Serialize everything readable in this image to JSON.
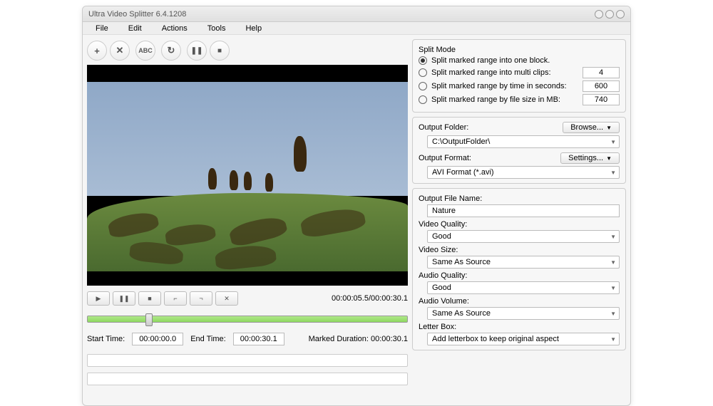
{
  "window": {
    "title": "Ultra Video Splitter 6.4.1208"
  },
  "menu": {
    "file": "File",
    "edit": "Edit",
    "actions": "Actions",
    "tools": "Tools",
    "help": "Help"
  },
  "toolbar": {
    "add": "+",
    "remove": "✕",
    "abc": "ABC",
    "refresh": "↻",
    "pause": "❚❚",
    "stop": "■"
  },
  "playback": {
    "play": "▶",
    "pause": "❚❚",
    "stop": "■",
    "markin": "⌐",
    "markout": "¬",
    "clear": "✕",
    "time": "00:00:05.5/00:00:30.1"
  },
  "time": {
    "startLabel": "Start Time:",
    "startValue": "00:00:00.0",
    "endLabel": "End Time:",
    "endValue": "00:00:30.1",
    "durationLabel": "Marked Duration: 00:00:30.1"
  },
  "splitMode": {
    "title": "Split Mode",
    "opt1": "Split  marked range into one block.",
    "opt2": "Split marked range into multi clips:",
    "opt2val": "4",
    "opt3": "Split marked range by time in seconds:",
    "opt3val": "600",
    "opt4": "Split marked range by file size in MB:",
    "opt4val": "740"
  },
  "output": {
    "folderLabel": "Output Folder:",
    "browse": "Browse...",
    "folderValue": "C:\\OutputFolder\\",
    "formatLabel": "Output Format:",
    "settings": "Settings...",
    "formatValue": "AVI Format (*.avi)"
  },
  "settings": {
    "fileNameLabel": "Output File Name:",
    "fileNameValue": "Nature",
    "videoQualityLabel": "Video Quality:",
    "videoQualityValue": "Good",
    "videoSizeLabel": "Video Size:",
    "videoSizeValue": "Same As Source",
    "audioQualityLabel": "Audio Quality:",
    "audioQualityValue": "Good",
    "audioVolumeLabel": "Audio Volume:",
    "audioVolumeValue": "Same As Source",
    "letterBoxLabel": "Letter Box:",
    "letterBoxValue": "Add letterbox to keep original aspect"
  }
}
